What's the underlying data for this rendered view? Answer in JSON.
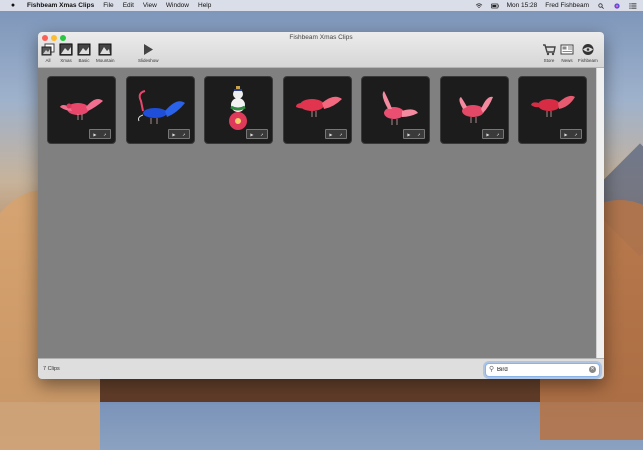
{
  "menubar": {
    "app_name": "Fishbeam Xmas Clips",
    "menus": [
      "File",
      "Edit",
      "View",
      "Window",
      "Help"
    ],
    "clock": "Mon 15:28",
    "user": "Fred Fishbeam"
  },
  "window": {
    "title": "Fishbeam Xmas Clips"
  },
  "toolbar": {
    "left": [
      {
        "label": "All",
        "icon": "all-clips-icon"
      },
      {
        "label": "Xmas",
        "icon": "xmas-icon",
        "selected": true
      },
      {
        "label": "Basic",
        "icon": "basic-icon"
      },
      {
        "label": "Mountain",
        "icon": "mountain-icon"
      }
    ],
    "slideshow_label": "Slideshow",
    "right": [
      {
        "label": "Store",
        "icon": "cart-icon"
      },
      {
        "label": "News",
        "icon": "news-icon"
      },
      {
        "label": "Fishbeam",
        "icon": "fishbeam-icon"
      }
    ]
  },
  "clips": [
    {
      "name": "pink bird",
      "kind": "bird",
      "body_color": "#e8476b",
      "tail_color": "#f06f8e"
    },
    {
      "name": "blue peacock bird",
      "kind": "peacock",
      "body_color": "#1f4fd8",
      "tail_color": "#f04a6a"
    },
    {
      "name": "snowman ornament",
      "kind": "ornament",
      "body_color": "#e03a5a",
      "tail_color": "#2d8a3e"
    },
    {
      "name": "red bird",
      "kind": "bird",
      "body_color": "#e0344f",
      "tail_color": "#f2687f"
    },
    {
      "name": "pink bird 2",
      "kind": "bird",
      "body_color": "#ea4f72",
      "tail_color": "#f38aa0"
    },
    {
      "name": "pink bird 3",
      "kind": "bird",
      "body_color": "#e34866",
      "tail_color": "#f38aa0"
    },
    {
      "name": "red bird 2",
      "kind": "bird",
      "body_color": "#d82c45",
      "tail_color": "#e85a70"
    }
  ],
  "footer": {
    "count_label": "7 Clips"
  },
  "search": {
    "value": "Bird",
    "placeholder": "Search"
  }
}
